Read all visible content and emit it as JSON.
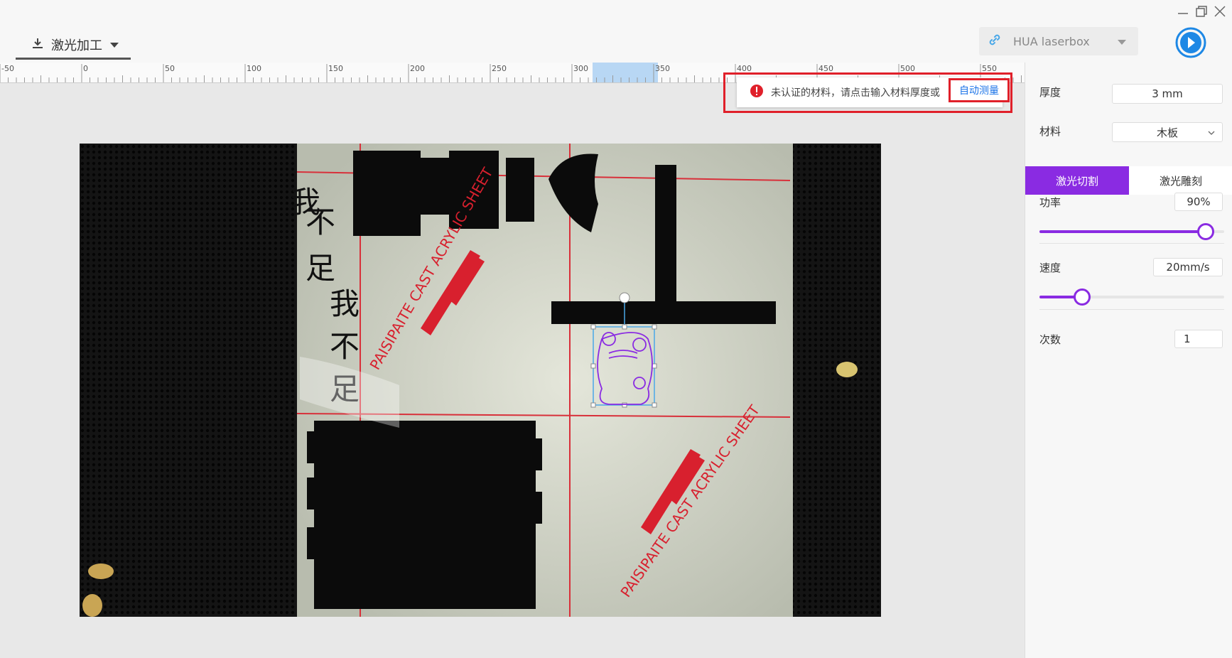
{
  "window": {
    "controls": {
      "minimize_icon": "minimize-icon",
      "restore_icon": "restore-icon",
      "close_icon": "close-icon"
    }
  },
  "header": {
    "mode_label": "激光加工",
    "device_name": "HUA laserbox"
  },
  "ruler": {
    "labels": [
      "-50",
      "0",
      "50",
      "100",
      "150",
      "200",
      "250",
      "300",
      "350",
      "400",
      "450",
      "500",
      "550"
    ]
  },
  "notification": {
    "message": "未认证的材料，请点击输入材料厚度或",
    "link": "自动测量"
  },
  "panel": {
    "thickness_label": "厚度",
    "thickness_value": "3 mm",
    "material_label": "材料",
    "material_value": "木板",
    "tab_cut": "激光切割",
    "tab_engrave": "激光雕刻",
    "power_label": "功率",
    "power_value": "90%",
    "power_level": 0.9,
    "speed_label": "速度",
    "speed_value": "20mm/s",
    "speed_level": 0.23,
    "passes_label": "次数",
    "passes_value": "1"
  },
  "photo": {
    "sheet_text_1": "PAISIPAITE CAST ACRYLIC SHEET",
    "sheet_text_2": "PAISIPAITE CAST ACRYLIC SHEET",
    "calligraphy_1": "我不足",
    "calligraphy_2": "我不足"
  }
}
